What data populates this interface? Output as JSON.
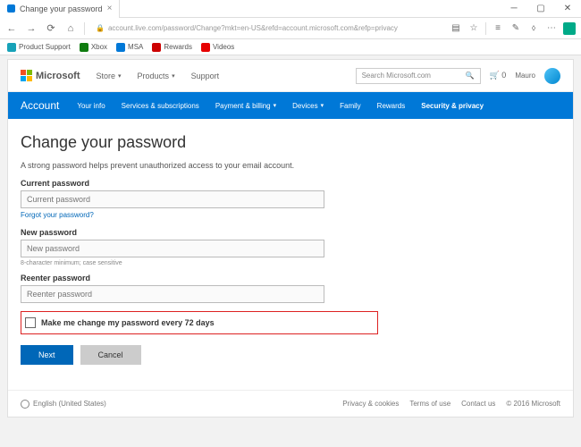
{
  "browser": {
    "tab_title": "Change your password",
    "url": "account.live.com/password/Change?mkt=en-US&refd=account.microsoft.com&refp=privacy",
    "favorites": [
      "Product Support",
      "Xbox",
      "MSA",
      "Rewards",
      "Videos"
    ]
  },
  "header": {
    "brand": "Microsoft",
    "nav": {
      "store": "Store",
      "products": "Products",
      "support": "Support"
    },
    "search_placeholder": "Search Microsoft.com",
    "cart_count": "0",
    "user_name": "Mauro"
  },
  "account_nav": {
    "title": "Account",
    "items": {
      "info": "Your info",
      "services": "Services & subscriptions",
      "payment": "Payment & billing",
      "devices": "Devices",
      "family": "Family",
      "rewards": "Rewards",
      "security": "Security & privacy"
    }
  },
  "page": {
    "title": "Change your password",
    "subtitle": "A strong password helps prevent unauthorized access to your email account.",
    "current_label": "Current password",
    "current_placeholder": "Current password",
    "forgot": "Forgot your password?",
    "new_label": "New password",
    "new_placeholder": "New password",
    "hint": "8-character minimum; case sensitive",
    "reenter_label": "Reenter password",
    "reenter_placeholder": "Reenter password",
    "checkbox_label": "Make me change my password every 72 days",
    "next": "Next",
    "cancel": "Cancel"
  },
  "footer": {
    "locale": "English (United States)",
    "links": {
      "privacy": "Privacy & cookies",
      "terms": "Terms of use",
      "contact": "Contact us"
    },
    "copyright": "© 2016 Microsoft"
  }
}
